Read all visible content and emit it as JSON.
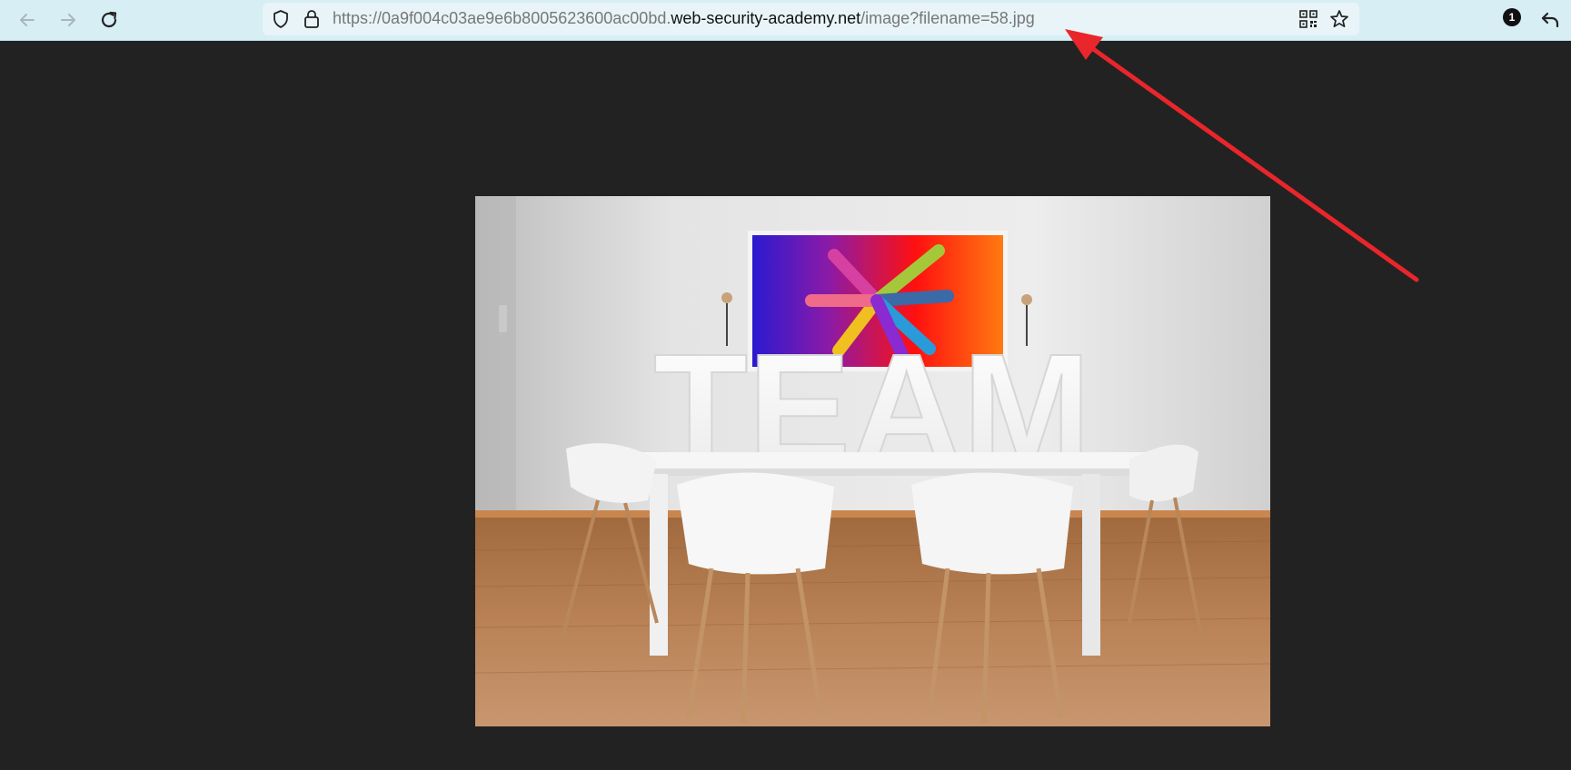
{
  "browser": {
    "url_prefix": "https://0a9f004c03ae9e6b8005623600ac00bd.",
    "url_host": "web-security-academy.net",
    "url_path": "/image?filename=58.jpg",
    "notification_count": "1"
  },
  "image": {
    "sign_text": "TEAM",
    "description_icon": "team-room-photo"
  },
  "colors": {
    "toolbar_bg": "#d7eef5",
    "page_bg": "#222222",
    "annotation_arrow": "#e8262b"
  }
}
